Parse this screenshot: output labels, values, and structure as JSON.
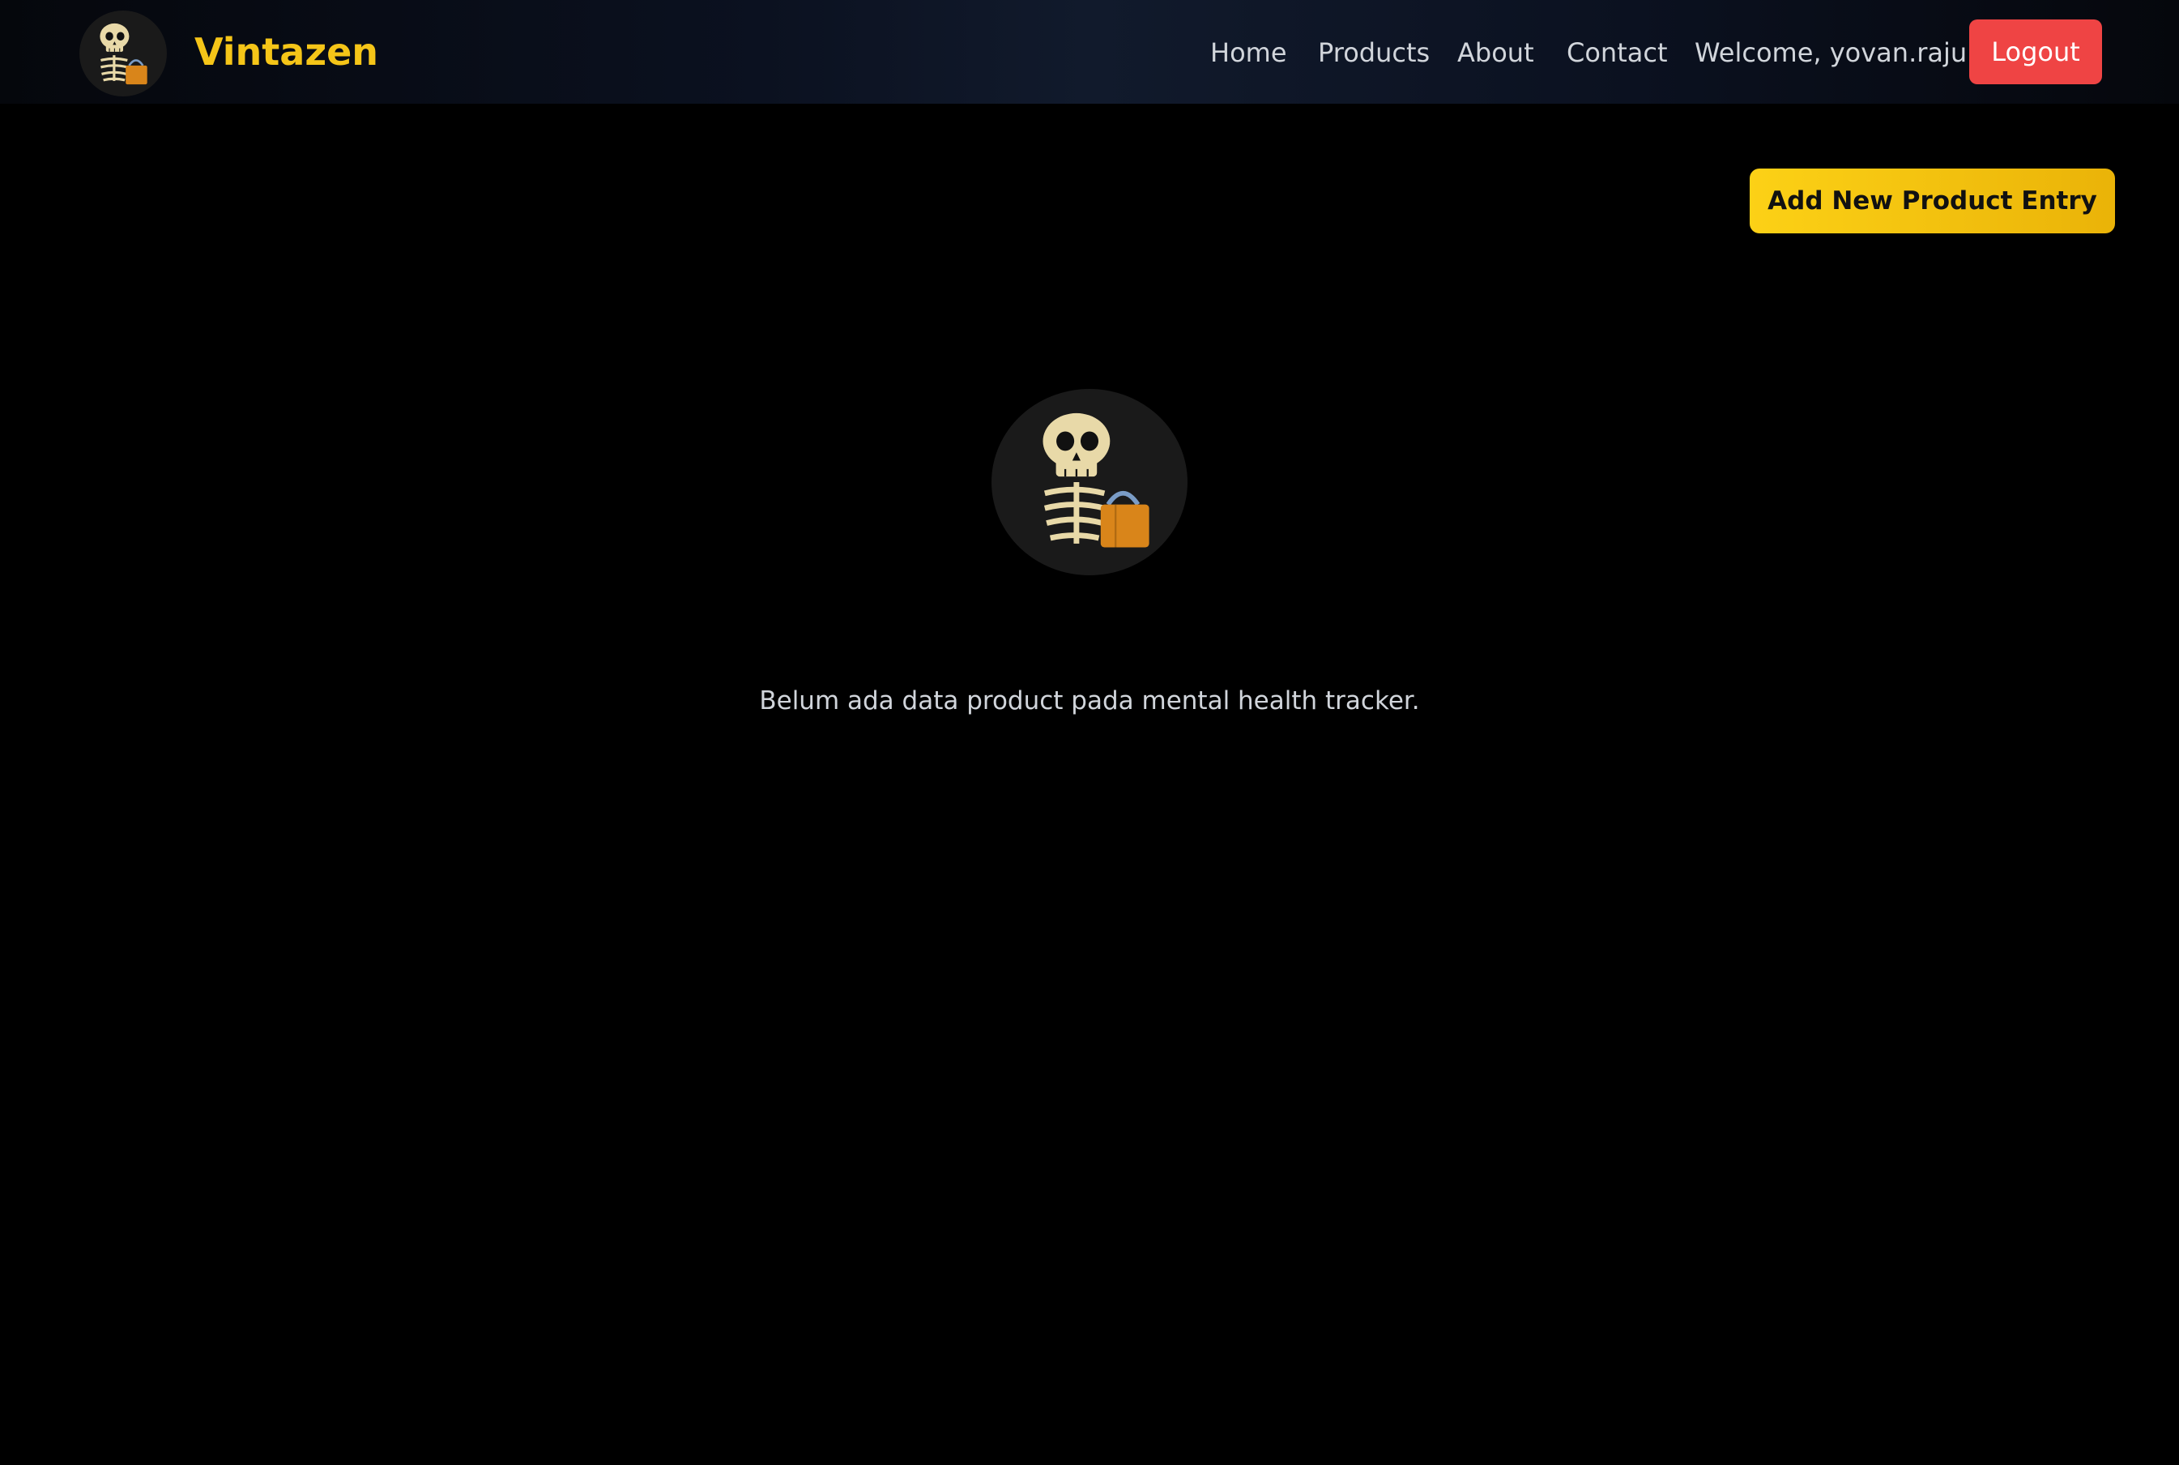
{
  "navbar": {
    "brand": "Vintazen",
    "links": [
      "Home",
      "Products",
      "About",
      "Contact"
    ],
    "welcome": "Welcome, yovan.raju",
    "logout_label": "Logout",
    "logo_icon": "skeleton-shopping-icon"
  },
  "main": {
    "add_button_label": "Add New Product Entry",
    "empty_icon": "skeleton-shopping-icon",
    "empty_message": "Belum ada data product pada mental health tracker."
  },
  "colors": {
    "brand": "#f5c518",
    "logout": "#ef4444",
    "add_button": "#fcd116",
    "background": "#000000"
  }
}
